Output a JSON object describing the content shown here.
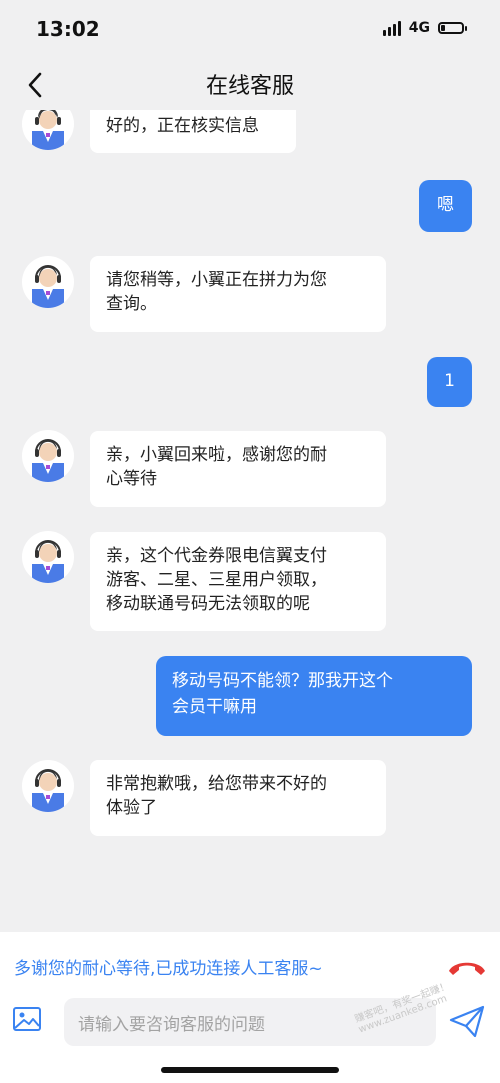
{
  "status": {
    "time": "13:02",
    "network": "4G",
    "battery_level": 0.2
  },
  "header": {
    "title": "在线客服"
  },
  "chat": {
    "messages": [
      {
        "side": "left",
        "text": "好的，正在核实信息"
      },
      {
        "side": "right",
        "text": "嗯"
      },
      {
        "side": "left",
        "lines": [
          "请您稍等，小翼正在拼力为您",
          "查询。"
        ]
      },
      {
        "side": "right",
        "text": "1"
      },
      {
        "side": "left",
        "lines": [
          "亲，小翼回来啦，感谢您的耐",
          "心等待"
        ]
      },
      {
        "side": "left",
        "lines": [
          "亲，这个代金券限电信翼支付",
          "游客、二星、三星用户领取，",
          "移动联通号码无法领取的呢"
        ]
      },
      {
        "side": "right",
        "lines": [
          "移动号码不能领？那我开这个",
          "会员干嘛用"
        ]
      },
      {
        "side": "left",
        "lines": [
          "非常抱歉哦，给您带来不好的",
          "体验了"
        ]
      }
    ]
  },
  "footer": {
    "notice": "多谢您的耐心等待,已成功连接人工客服~",
    "input_placeholder": "请输入要咨询客服的问题",
    "watermark": "赚客吧，有奖一起赚！www.zuanke8.com"
  },
  "colors": {
    "accent": "#3a83f1",
    "hangup": "#e53935"
  }
}
